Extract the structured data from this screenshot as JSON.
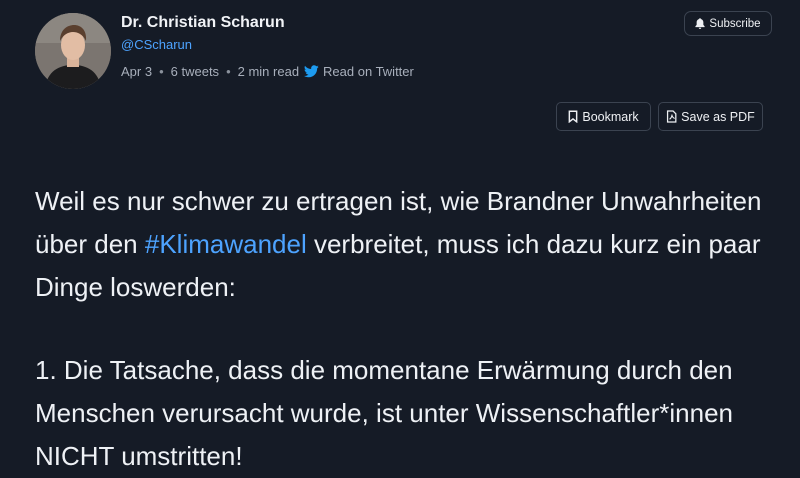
{
  "author": {
    "name": "Dr. Christian Scharun",
    "handle": "@CScharun"
  },
  "meta": {
    "date": "Apr 3",
    "tweets": "6 tweets",
    "read_time": "2 min read",
    "read_on": "Read on Twitter"
  },
  "buttons": {
    "subscribe": "Subscribe",
    "bookmark": "Bookmark",
    "save_pdf": "Save as PDF"
  },
  "tweet": {
    "p1_before": "Weil es nur schwer zu ertragen ist, wie Brandner Unwahrheiten über den ",
    "p1_hashtag": "#Klimawandel",
    "p1_after": " verbreitet, muss ich dazu kurz ein paar Dinge loswerden:",
    "p2": "1. Die Tatsache, dass die momentane Erwärmung durch den Menschen verursacht wurde, ist unter Wissenschaftler*innen NICHT umstritten!"
  },
  "colors": {
    "background": "#151b26",
    "link": "#4da3ff",
    "twitter_blue": "#1d9bf0"
  },
  "icons": [
    "bell-icon",
    "twitter-bird-icon",
    "bookmark-icon",
    "pdf-icon"
  ]
}
